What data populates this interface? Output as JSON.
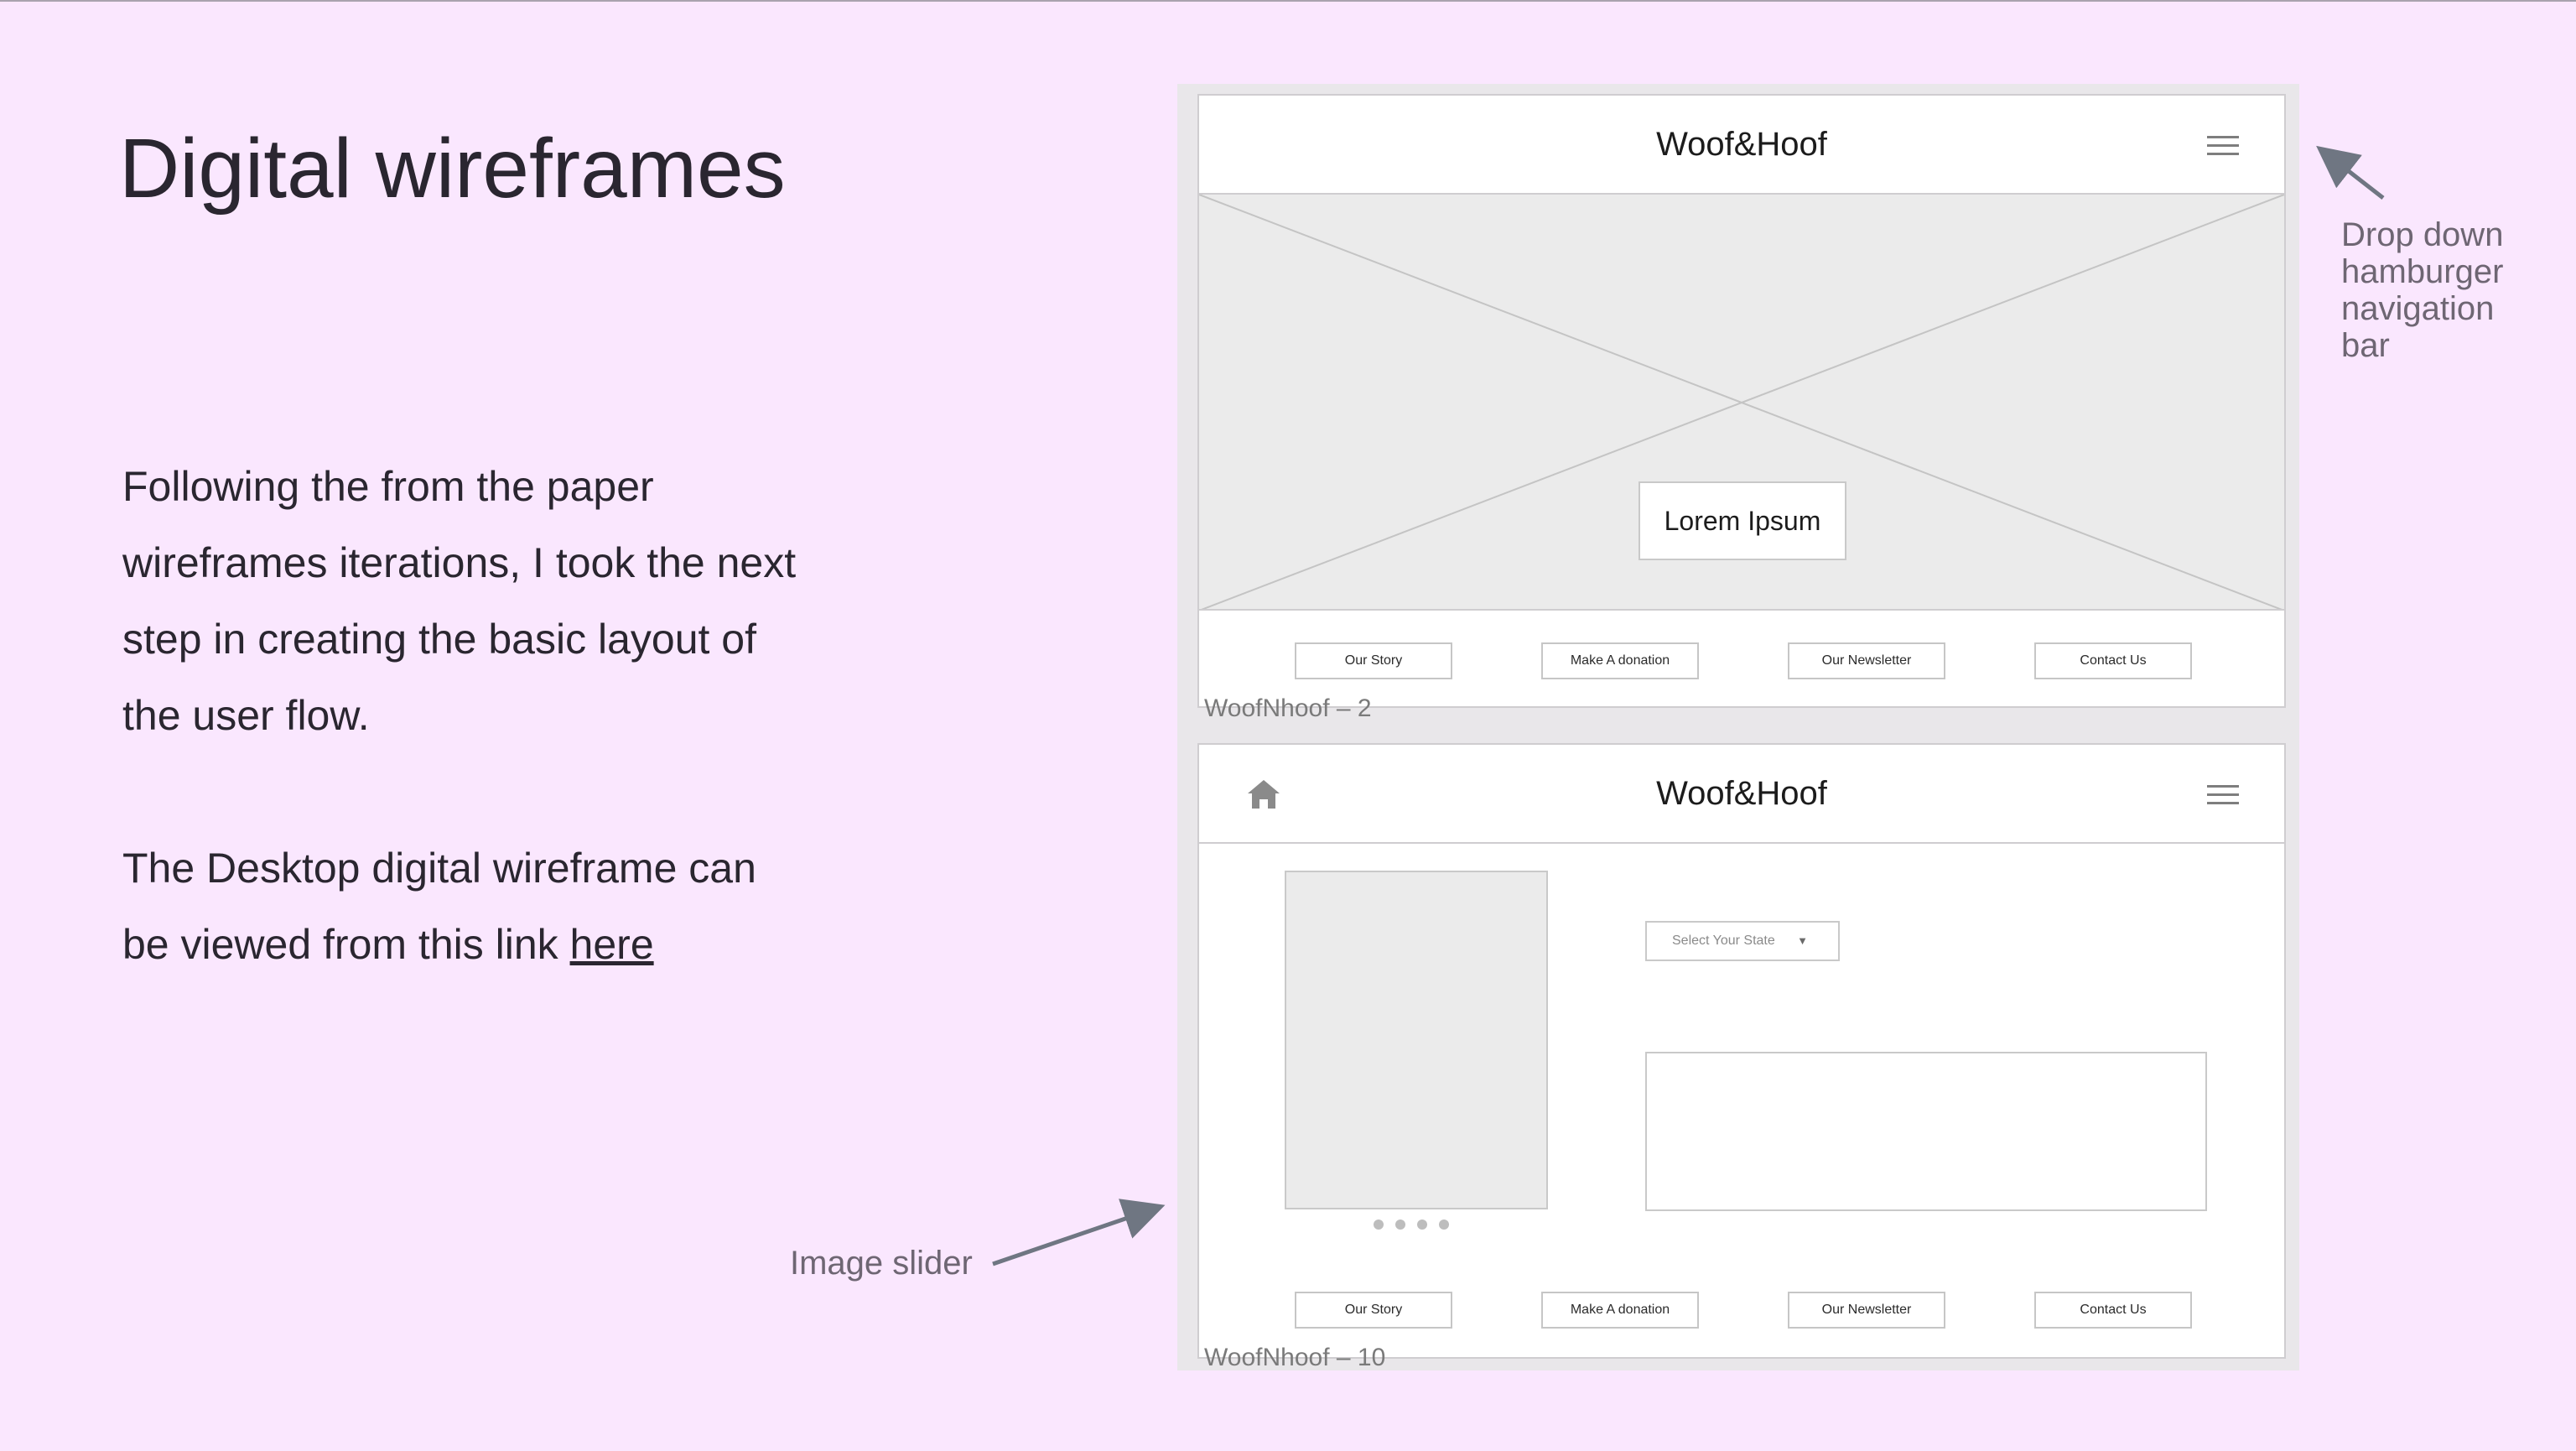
{
  "slide": {
    "title": "Digital wireframes",
    "paragraph_1": "Following the from the paper wireframes iterations, I took the next step in creating the basic layout of the user flow.",
    "paragraph_2_prefix": "The Desktop digital wireframe can be viewed from this link ",
    "link_text": "here"
  },
  "wireframe_a": {
    "label": "WoofNhoof – 2",
    "logo": "Woof&Hoof",
    "hero_button": "Lorem Ipsum",
    "icons": {
      "menu": "hamburger-icon"
    }
  },
  "wireframe_b": {
    "label": "WoofNhoof – 10",
    "logo": "Woof&Hoof",
    "select_placeholder": "Select Your State",
    "slider_dot_count": 4,
    "icons": {
      "home": "home-icon",
      "menu": "hamburger-icon",
      "select": "caret-down-icon"
    }
  },
  "footer_nav": [
    "Our Story",
    "Make A donation",
    "Our Newsletter",
    "Contact Us"
  ],
  "annotations": {
    "nav_lines": [
      "Drop down",
      "hamburger",
      "navigation",
      "bar"
    ],
    "slider": "Image slider"
  },
  "colors": {
    "background": "#fae7fe",
    "board": "#e9e7ea",
    "annotation": "#6e6673",
    "arrow": "#6f7682"
  }
}
